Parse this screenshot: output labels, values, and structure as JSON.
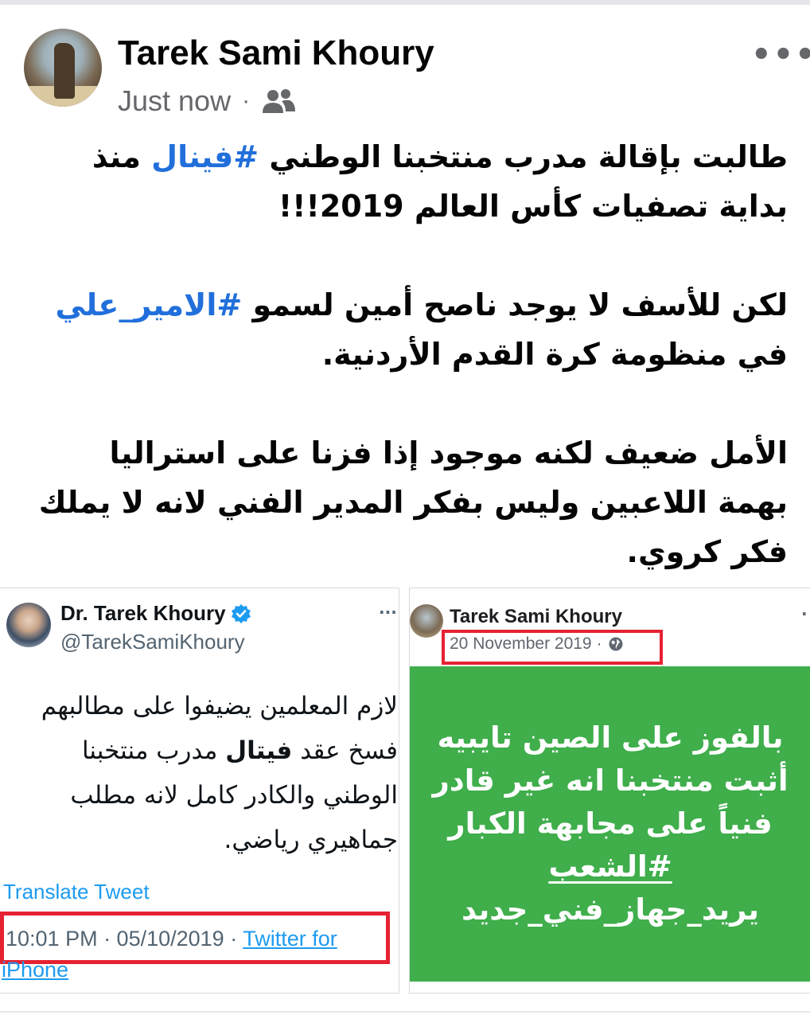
{
  "post": {
    "author": "Tarek Sami Khoury",
    "timestamp": "Just now",
    "separator": "·",
    "audience_icon": "friends-icon",
    "more_icon": "•••",
    "p1_a": "طالبت بإقالة مدرب منتخبنا الوطني ",
    "p1_tag": "#فينال",
    "p1_b": " منذ بداية تصفيات كأس العالم 2019!!!",
    "p2_a": "لكن للأسف لا يوجد ناصح أمين لسمو ",
    "p2_tag": "#الامير_علي",
    "p2_b": " في منظومة كرة القدم الأردنية.",
    "p3": "الأمل ضعيف لكنه موجود إذا فزنا على استراليا بهمة اللاعبين وليس بفكر المدير الفني لانه لا يملك فكر كروي."
  },
  "tweet": {
    "name": "Dr. Tarek Khoury",
    "handle": "@TarekSamiKhoury",
    "more": "···",
    "text_a": "لازم المعلمين يضيفوا على مطالبهم فسخ عقد ",
    "text_bold": "فيتال",
    "text_b": " مدرب منتخبنا الوطني والكادر كامل لانه مطلب جماهيري رياضي.",
    "translate": "Translate Tweet",
    "time": "10:01 PM · 05/10/2019 · ",
    "source_1": "Twitter for",
    "source_2": "iPhone"
  },
  "fb_post": {
    "name": "Tarek Sami Khoury",
    "date": "20 November 2019 ·",
    "more": "·",
    "image_lines": [
      "بالفوز على الصين تايبيه",
      "أثبت منتخبنا انه غير قادر",
      "فنياً على مجابهة الكبار",
      "#الشعب",
      "يريد_جهاز_فني_جديد"
    ]
  },
  "colors": {
    "hashtag": "#216fdb",
    "highlight_box": "#e52232",
    "image_bg": "#3fae4b",
    "twitter_blue": "#1d9bf0"
  }
}
